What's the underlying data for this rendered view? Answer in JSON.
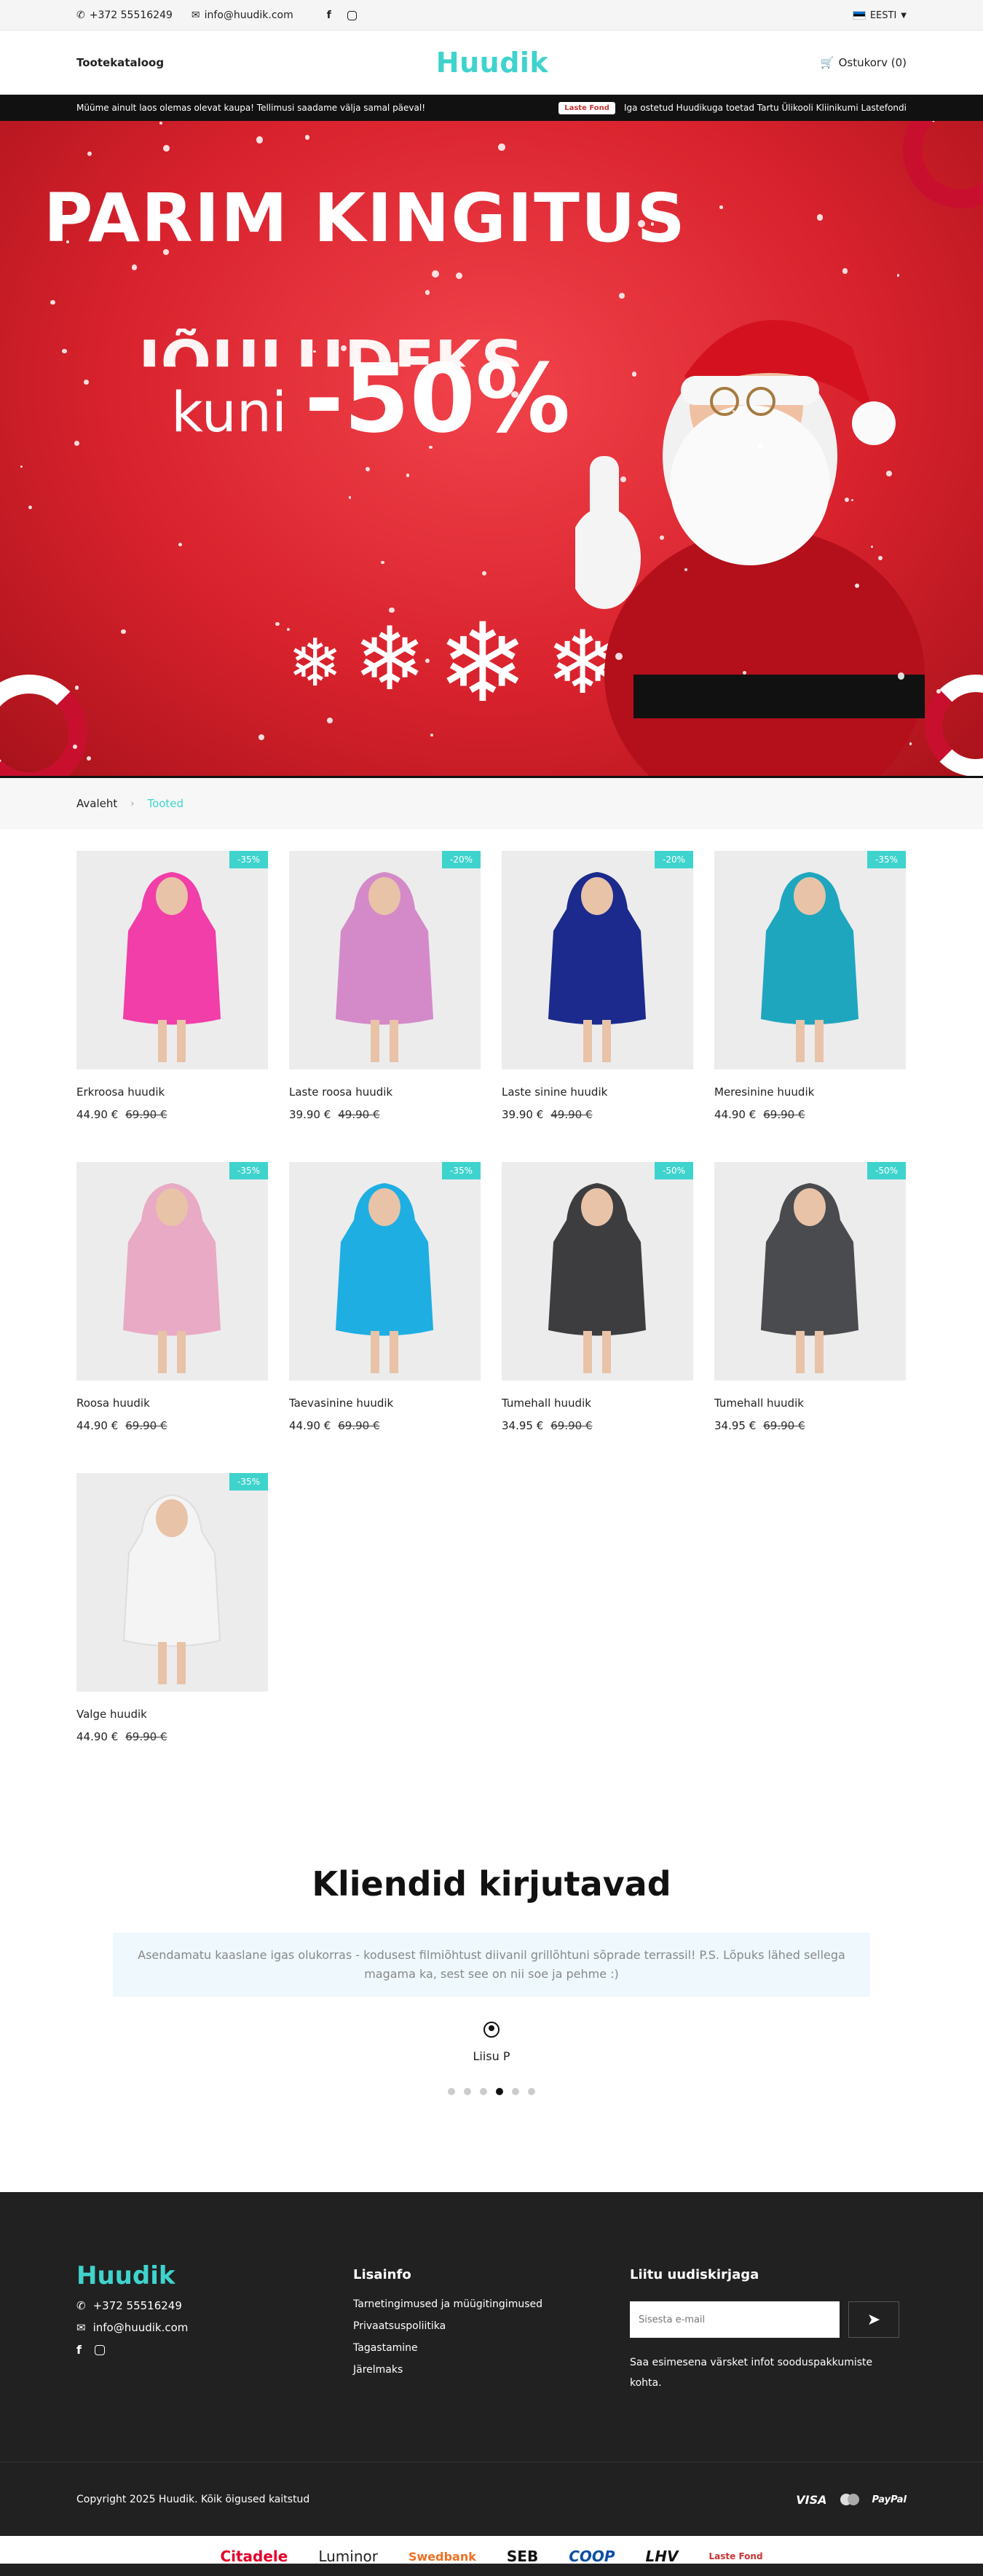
{
  "topbar": {
    "phone": "+372 55516249",
    "email": "info@huudik.com",
    "language": "EESTI",
    "icons": [
      "phone-icon",
      "envelope-icon",
      "facebook-icon",
      "instagram-icon",
      "chevron-down-icon"
    ]
  },
  "header": {
    "catalog_link": "Tootekataloog",
    "logo": "Huudik",
    "cart": "Ostukorv (0)"
  },
  "ticker": {
    "left": "Müüme ainult laos olemas olevat kaupa! Tellimusi saadame välja samal päeval!",
    "badge": "Laste Fond",
    "right": "Iga ostetud Huudikuga toetad Tartu Ülikooli Kliinikumi Lastefondi"
  },
  "hero": {
    "line1": "PARIM KINGITUS",
    "line2": "JÕULUDEKS",
    "line3_prefix": "kuni",
    "line3": "-50%"
  },
  "breadcrumb": {
    "home": "Avaleht",
    "current": "Tooted"
  },
  "products": [
    {
      "name": "Erkroosa huudik",
      "price": "44.90 €",
      "old": "69.90 €",
      "tag": "-35%",
      "color": "#f13ea8"
    },
    {
      "name": "Laste roosa huudik",
      "price": "39.90 €",
      "old": "49.90 €",
      "tag": "-20%",
      "color": "#d48ac8"
    },
    {
      "name": "Laste sinine huudik",
      "price": "39.90 €",
      "old": "49.90 €",
      "tag": "-20%",
      "color": "#1b2a8c"
    },
    {
      "name": "Meresinine huudik",
      "price": "44.90 €",
      "old": "69.90 €",
      "tag": "-35%",
      "color": "#1ea6bf"
    },
    {
      "name": "Roosa huudik",
      "price": "44.90 €",
      "old": "69.90 €",
      "tag": "-35%",
      "color": "#e8aac4"
    },
    {
      "name": "Taevasinine huudik",
      "price": "44.90 €",
      "old": "69.90 €",
      "tag": "-35%",
      "color": "#1eaee2"
    },
    {
      "name": "Tumehall huudik",
      "price": "34.95 €",
      "old": "69.90 €",
      "tag": "-50%",
      "color": "#3d3d40"
    },
    {
      "name": "Tumehall huudik",
      "price": "34.95 €",
      "old": "69.90 €",
      "tag": "-50%",
      "color": "#4a4b4f"
    },
    {
      "name": "Valge huudik",
      "price": "44.90 €",
      "old": "69.90 €",
      "tag": "-35%",
      "color": "#f4f4f4"
    }
  ],
  "testimonials": {
    "title": "Kliendid kirjutavad",
    "quote": "Asendamatu kaaslane igas olukorras - kodusest filmiõhtust diivanil grillõhtuni sõprade terrassil! P.S. Lõpuks lähed sellega magama ka, sest see on nii soe ja pehme :)",
    "author": "Liisu P",
    "dot_count": 6,
    "active_dot": 3
  },
  "footer": {
    "logo": "Huudik",
    "phone": "+372 55516249",
    "email": "info@huudik.com",
    "info_title": "Lisainfo",
    "links": [
      "Tarnetingimused ja müügitingimused",
      "Privaatsuspoliitika",
      "Tagastamine",
      "Järelmaks"
    ],
    "newsletter_title": "Liitu uudiskirjaga",
    "newsletter_placeholder": "Sisesta e-mail",
    "newsletter_text": "Saa esimesena värsket infot sooduspakkumiste kohta.",
    "copyright": "Copyright 2025 Huudik. Kõik õigused kaitstud",
    "payments": [
      "VISA",
      "MC",
      "PayPal"
    ]
  },
  "partners": [
    "Citadele",
    "Luminor",
    "Swedbank",
    "SEB",
    "COOP",
    "LHV",
    "Laste Fond"
  ],
  "colors": {
    "accent": "#3fd3cd",
    "footer": "#212121",
    "hero_red": "#d8222d"
  }
}
